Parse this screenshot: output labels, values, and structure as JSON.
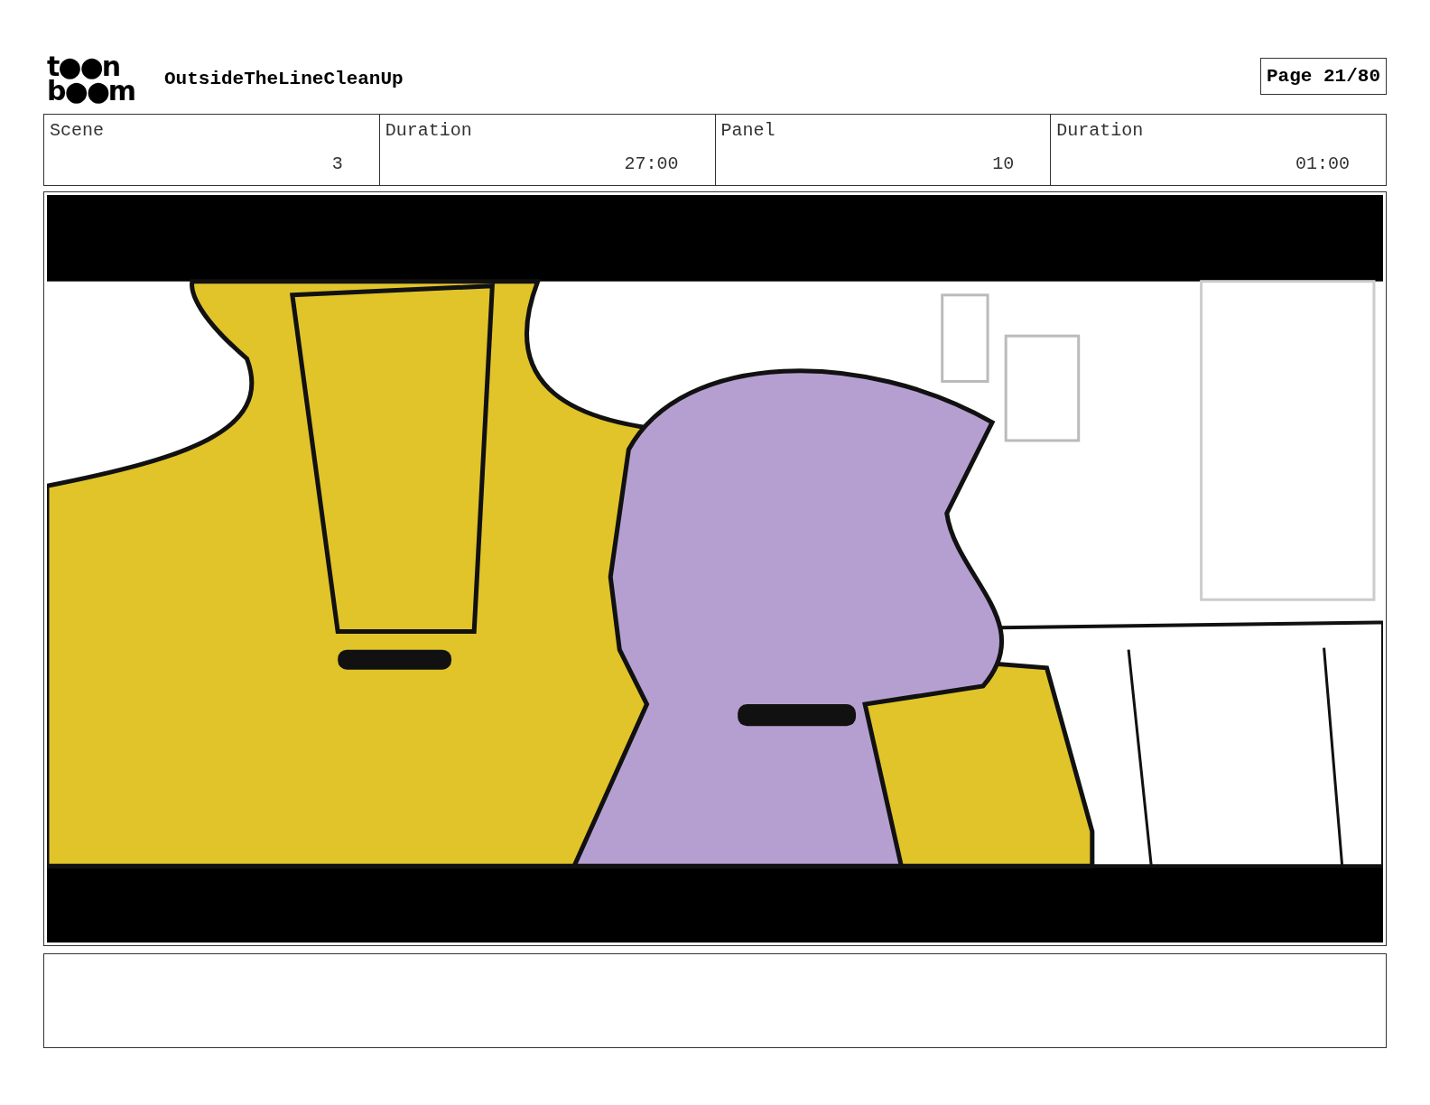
{
  "header": {
    "logo": [
      "t●●n",
      "b●●m"
    ],
    "project": "OutsideTheLineCleanUp",
    "page": "Page 21/80"
  },
  "info": [
    {
      "label": "Scene",
      "value": "3"
    },
    {
      "label": "Duration",
      "value": "27:00"
    },
    {
      "label": "Panel",
      "value": "10"
    },
    {
      "label": "Duration",
      "value": "01:00"
    }
  ]
}
